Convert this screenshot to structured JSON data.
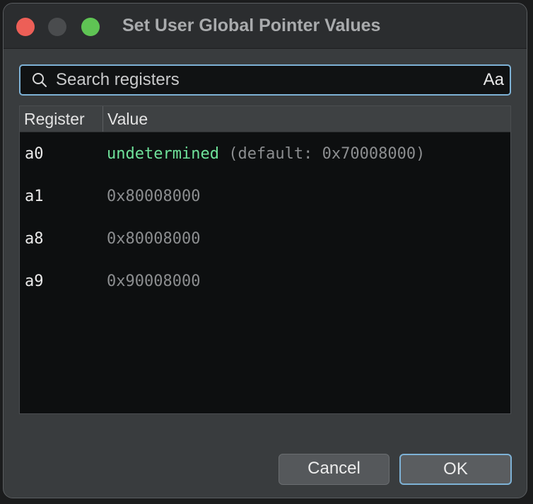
{
  "window": {
    "title": "Set User Global Pointer Values"
  },
  "search": {
    "placeholder": "Search registers",
    "value": "",
    "case_toggle_label": "Aa"
  },
  "table": {
    "columns": [
      "Register",
      "Value"
    ],
    "rows": [
      {
        "register": "a0",
        "value_primary": "undetermined",
        "value_secondary": " (default: 0x70008000)"
      },
      {
        "register": "a1",
        "value_primary": "",
        "value_secondary": "0x80008000"
      },
      {
        "register": "a8",
        "value_primary": "",
        "value_secondary": "0x80008000"
      },
      {
        "register": "a9",
        "value_primary": "",
        "value_secondary": "0x90008000"
      }
    ]
  },
  "buttons": {
    "cancel_label": "Cancel",
    "ok_label": "OK"
  },
  "colors": {
    "accent": "#7eb2d6",
    "undetermined": "#6fe29a",
    "close": "#ed5f57",
    "zoom": "#5fc454"
  },
  "icons": {
    "search": "search-icon"
  }
}
